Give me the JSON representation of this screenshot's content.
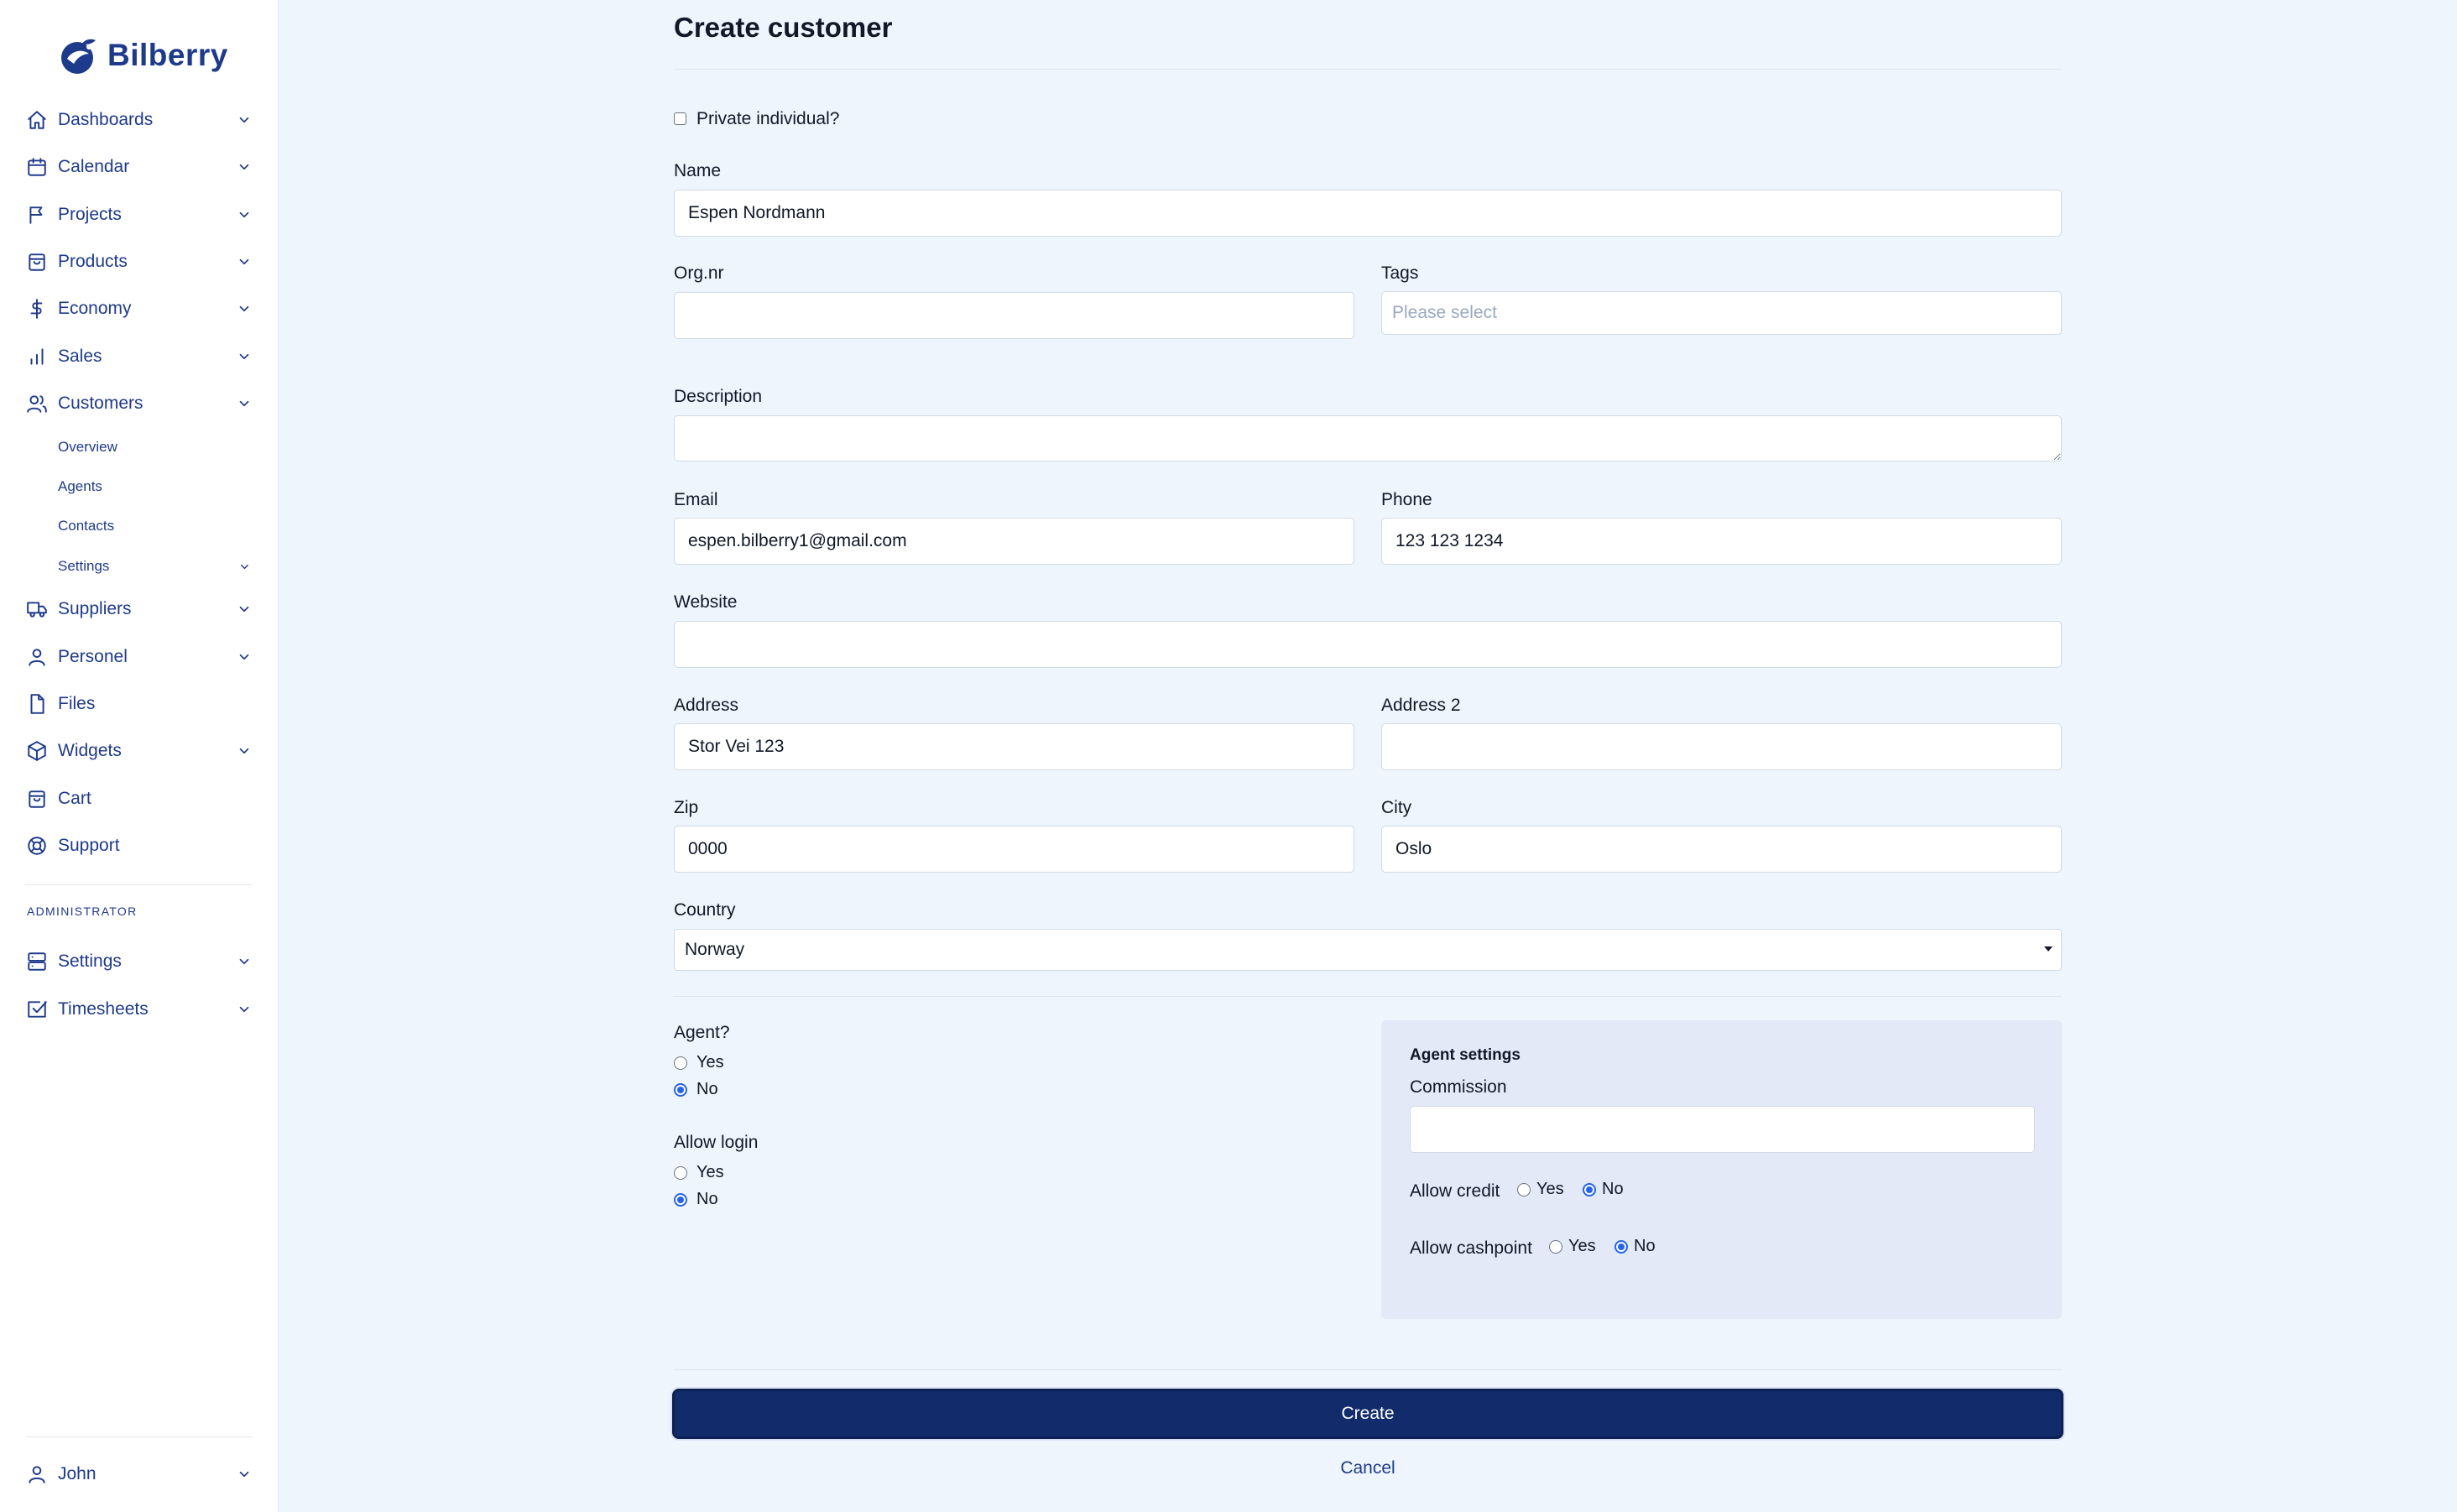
{
  "brand": {
    "name": "Bilberry"
  },
  "sidebar": {
    "items": [
      {
        "label": "Dashboards",
        "icon": "home-icon"
      },
      {
        "label": "Calendar",
        "icon": "calendar-icon"
      },
      {
        "label": "Projects",
        "icon": "flag-icon"
      },
      {
        "label": "Products",
        "icon": "bag-icon"
      },
      {
        "label": "Economy",
        "icon": "dollar-icon"
      },
      {
        "label": "Sales",
        "icon": "bar-chart-icon"
      },
      {
        "label": "Customers",
        "icon": "users-icon"
      }
    ],
    "customers_sub": [
      "Overview",
      "Agents",
      "Contacts",
      "Settings"
    ],
    "items2": [
      {
        "label": "Suppliers",
        "icon": "truck-icon"
      },
      {
        "label": "Personel",
        "icon": "user-icon"
      },
      {
        "label": "Files",
        "icon": "file-icon"
      },
      {
        "label": "Widgets",
        "icon": "cube-icon"
      },
      {
        "label": "Cart",
        "icon": "cart-icon"
      },
      {
        "label": "Support",
        "icon": "lifebuoy-icon"
      }
    ],
    "admin_section": "ADMINISTRATOR",
    "admin_items": [
      {
        "label": "Settings",
        "icon": "server-icon"
      },
      {
        "label": "Timesheets",
        "icon": "checkbox-icon"
      }
    ],
    "user": {
      "label": "John",
      "icon": "user-icon"
    }
  },
  "form": {
    "title": "Create customer",
    "private_label": "Private individual?",
    "name": {
      "label": "Name",
      "value": "Espen Nordmann"
    },
    "orgnr": {
      "label": "Org.nr",
      "value": ""
    },
    "tags": {
      "label": "Tags",
      "placeholder": "Please select"
    },
    "description": {
      "label": "Description",
      "value": ""
    },
    "email": {
      "label": "Email",
      "value": "espen.bilberry1@gmail.com"
    },
    "phone": {
      "label": "Phone",
      "value": "123 123 1234"
    },
    "website": {
      "label": "Website",
      "value": ""
    },
    "address": {
      "label": "Address",
      "value": "Stor Vei 123"
    },
    "address2": {
      "label": "Address 2",
      "value": ""
    },
    "zip": {
      "label": "Zip",
      "value": "0000"
    },
    "city": {
      "label": "City",
      "value": "Oslo"
    },
    "country": {
      "label": "Country",
      "value": "Norway"
    },
    "agent": {
      "label": "Agent?",
      "yes": "Yes",
      "no": "No",
      "selected": "No"
    },
    "allow_login": {
      "label": "Allow login",
      "yes": "Yes",
      "no": "No",
      "selected": "No"
    },
    "agent_settings": {
      "title": "Agent settings",
      "commission_label": "Commission",
      "commission_value": "",
      "allow_credit": {
        "label": "Allow credit",
        "yes": "Yes",
        "no": "No",
        "selected": "No"
      },
      "allow_cashpoint": {
        "label": "Allow cashpoint",
        "yes": "Yes",
        "no": "No",
        "selected": "No"
      }
    },
    "create_label": "Create",
    "cancel_label": "Cancel"
  },
  "colors": {
    "accent": "#1e3a8a",
    "button": "#122c6b",
    "radio": "#2563eb",
    "background": "#eef5fd"
  }
}
